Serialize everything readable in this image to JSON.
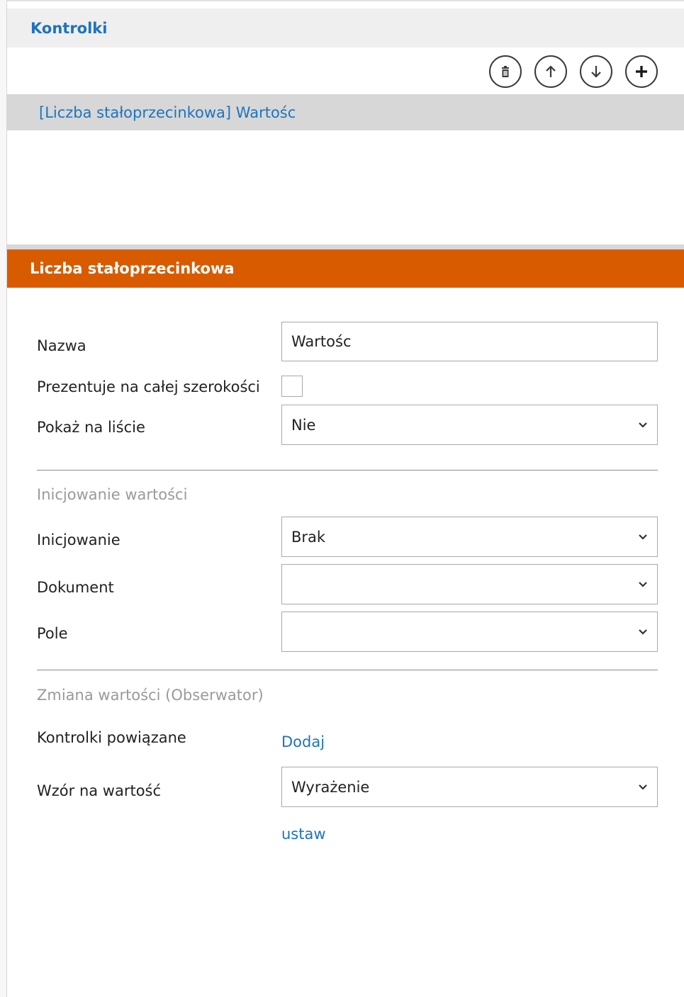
{
  "panel": {
    "title": "Kontrolki",
    "list_items": [
      {
        "label": "[Liczba stałoprzecinkowa] Wartośc"
      }
    ]
  },
  "section": {
    "title": "Liczba stałoprzecinkowa"
  },
  "form": {
    "nazwa_label": "Nazwa",
    "nazwa_value": "Wartośc",
    "full_width_label": "Prezentuje na całej szerokości",
    "show_on_list_label": "Pokaż na liście",
    "show_on_list_value": "Nie",
    "init_section": "Inicjowanie wartości",
    "init_label": "Inicjowanie",
    "init_value": "Brak",
    "document_label": "Dokument",
    "document_value": "",
    "field_label": "Pole",
    "field_value": "",
    "observer_section": "Zmiana wartości (Obserwator)",
    "related_label": "Kontrolki powiązane",
    "related_link": "Dodaj",
    "formula_label": "Wzór na wartość",
    "formula_value": "Wyrażenie",
    "set_link": "ustaw"
  },
  "toolbar": {
    "icons": [
      "trash-icon",
      "arrow-up-icon",
      "arrow-down-icon",
      "plus-icon"
    ]
  },
  "colors": {
    "accent_blue": "#1e73be",
    "section_orange": "#d85b00"
  }
}
